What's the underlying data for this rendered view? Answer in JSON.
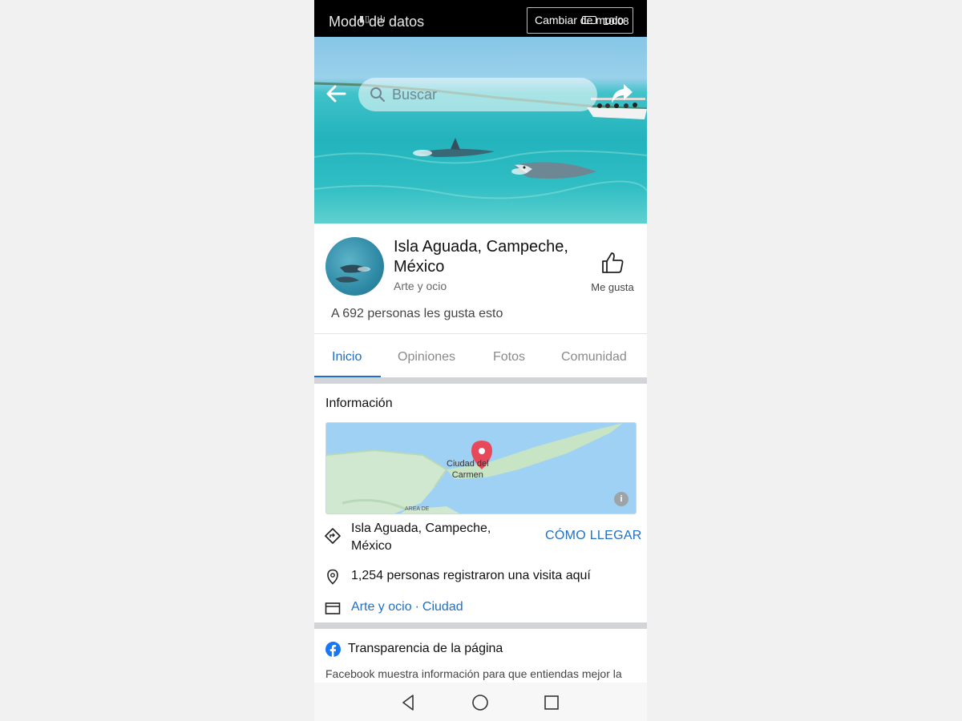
{
  "status_bar": {
    "mode_text": "Modo de datos",
    "change_button": "Cambiar de modo",
    "time": "10:08"
  },
  "search": {
    "placeholder": "Buscar"
  },
  "page": {
    "name": "Isla Aguada, Campeche, México",
    "category": "Arte y ocio",
    "like_label": "Me gusta",
    "likes_text": "A 692 personas les gusta esto"
  },
  "tabs": [
    {
      "label": "Inicio",
      "active": true
    },
    {
      "label": "Opiniones",
      "active": false
    },
    {
      "label": "Fotos",
      "active": false
    },
    {
      "label": "Comunidad",
      "active": false
    }
  ],
  "info": {
    "heading": "Información",
    "map_label_1": "Ciudad del",
    "map_label_2": "Carmen",
    "map_area_label": "AREA DE",
    "address": "Isla Aguada, Campeche, México",
    "directions_label": "CÓMO LLEGAR",
    "visits_text": "1,254 personas registraron una visita aquí",
    "categories": [
      "Arte y ocio",
      "Ciudad"
    ],
    "category_separator": "·"
  },
  "transparency": {
    "title": "Transparencia de la página",
    "description": "Facebook muestra información para que entiendas mejor la"
  },
  "colors": {
    "accent": "#1f6fc4",
    "map_pin": "#e8495a",
    "facebook_blue": "#1877f2"
  }
}
